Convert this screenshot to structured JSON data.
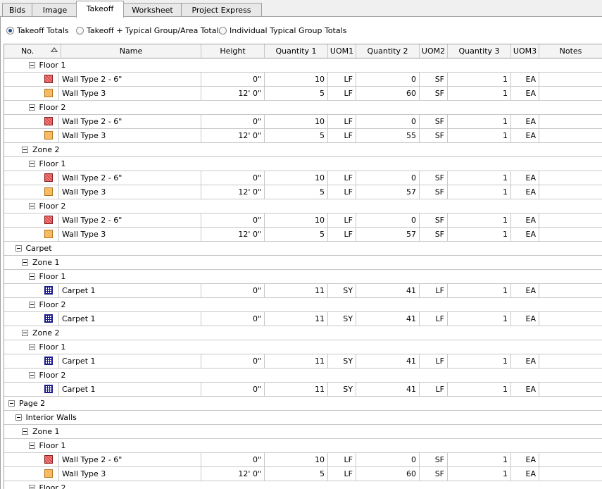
{
  "tabs": [
    "Bids",
    "Image",
    "Takeoff",
    "Worksheet",
    "Project Express"
  ],
  "active_tab": "Takeoff",
  "radio_options": [
    {
      "label": "Takeoff Totals",
      "selected": true
    },
    {
      "label": "Takeoff + Typical Group/Area Totals",
      "selected": false
    },
    {
      "label": "Individual Typical Group Totals",
      "selected": false
    }
  ],
  "columns": [
    "No.",
    "Name",
    "Height",
    "Quantity 1",
    "UOM1",
    "Quantity 2",
    "UOM2",
    "Quantity 3",
    "UOM3",
    "Notes"
  ],
  "rows": [
    {
      "type": "group",
      "level": 2,
      "label": "Floor 1"
    },
    {
      "type": "item",
      "swatch": "red",
      "name": "Wall Type 2 - 6\"",
      "height": "0\"",
      "q1": "10",
      "u1": "LF",
      "q2": "0",
      "u2": "SF",
      "q3": "1",
      "u3": "EA",
      "notes": ""
    },
    {
      "type": "item",
      "swatch": "orange",
      "name": "Wall Type 3",
      "height": "12' 0\"",
      "q1": "5",
      "u1": "LF",
      "q2": "60",
      "u2": "SF",
      "q3": "1",
      "u3": "EA",
      "notes": ""
    },
    {
      "type": "group",
      "level": 2,
      "label": "Floor 2"
    },
    {
      "type": "item",
      "swatch": "red",
      "name": "Wall Type 2 - 6\"",
      "height": "0\"",
      "q1": "10",
      "u1": "LF",
      "q2": "0",
      "u2": "SF",
      "q3": "1",
      "u3": "EA",
      "notes": ""
    },
    {
      "type": "item",
      "swatch": "orange",
      "name": "Wall Type 3",
      "height": "12' 0\"",
      "q1": "5",
      "u1": "LF",
      "q2": "55",
      "u2": "SF",
      "q3": "1",
      "u3": "EA",
      "notes": ""
    },
    {
      "type": "group",
      "level": 1,
      "label": "Zone 2"
    },
    {
      "type": "group",
      "level": 2,
      "label": "Floor 1"
    },
    {
      "type": "item",
      "swatch": "red",
      "name": "Wall Type 2 - 6\"",
      "height": "0\"",
      "q1": "10",
      "u1": "LF",
      "q2": "0",
      "u2": "SF",
      "q3": "1",
      "u3": "EA",
      "notes": ""
    },
    {
      "type": "item",
      "swatch": "orange",
      "name": "Wall Type 3",
      "height": "12' 0\"",
      "q1": "5",
      "u1": "LF",
      "q2": "57",
      "u2": "SF",
      "q3": "1",
      "u3": "EA",
      "notes": ""
    },
    {
      "type": "group",
      "level": 2,
      "label": "Floor 2"
    },
    {
      "type": "item",
      "swatch": "red",
      "name": "Wall Type 2 - 6\"",
      "height": "0\"",
      "q1": "10",
      "u1": "LF",
      "q2": "0",
      "u2": "SF",
      "q3": "1",
      "u3": "EA",
      "notes": ""
    },
    {
      "type": "item",
      "swatch": "orange",
      "name": "Wall Type 3",
      "height": "12' 0\"",
      "q1": "5",
      "u1": "LF",
      "q2": "57",
      "u2": "SF",
      "q3": "1",
      "u3": "EA",
      "notes": ""
    },
    {
      "type": "group",
      "level": 0,
      "label": "Carpet"
    },
    {
      "type": "group",
      "level": 1,
      "label": "Zone 1"
    },
    {
      "type": "group",
      "level": 2,
      "label": "Floor 1"
    },
    {
      "type": "item",
      "swatch": "blue",
      "name": "Carpet 1",
      "height": "0\"",
      "q1": "11",
      "u1": "SY",
      "q2": "41",
      "u2": "LF",
      "q3": "1",
      "u3": "EA",
      "notes": ""
    },
    {
      "type": "group",
      "level": 2,
      "label": "Floor 2"
    },
    {
      "type": "item",
      "swatch": "blue",
      "name": "Carpet 1",
      "height": "0\"",
      "q1": "11",
      "u1": "SY",
      "q2": "41",
      "u2": "LF",
      "q3": "1",
      "u3": "EA",
      "notes": ""
    },
    {
      "type": "group",
      "level": 1,
      "label": "Zone 2"
    },
    {
      "type": "group",
      "level": 2,
      "label": "Floor 1"
    },
    {
      "type": "item",
      "swatch": "blue",
      "name": "Carpet 1",
      "height": "0\"",
      "q1": "11",
      "u1": "SY",
      "q2": "41",
      "u2": "LF",
      "q3": "1",
      "u3": "EA",
      "notes": ""
    },
    {
      "type": "group",
      "level": 2,
      "label": "Floor 2"
    },
    {
      "type": "item",
      "swatch": "blue",
      "name": "Carpet 1",
      "height": "0\"",
      "q1": "11",
      "u1": "SY",
      "q2": "41",
      "u2": "LF",
      "q3": "1",
      "u3": "EA",
      "notes": ""
    },
    {
      "type": "group",
      "level": -1,
      "label": "Page 2"
    },
    {
      "type": "group",
      "level": 0,
      "label": "Interior Walls"
    },
    {
      "type": "group",
      "level": 1,
      "label": "Zone 1"
    },
    {
      "type": "group",
      "level": 2,
      "label": "Floor 1"
    },
    {
      "type": "item",
      "swatch": "red",
      "name": "Wall Type 2 - 6\"",
      "height": "0\"",
      "q1": "10",
      "u1": "LF",
      "q2": "0",
      "u2": "SF",
      "q3": "1",
      "u3": "EA",
      "notes": ""
    },
    {
      "type": "item",
      "swatch": "orange",
      "name": "Wall Type 3",
      "height": "12' 0\"",
      "q1": "5",
      "u1": "LF",
      "q2": "60",
      "u2": "SF",
      "q3": "1",
      "u3": "EA",
      "notes": ""
    },
    {
      "type": "group",
      "level": 2,
      "label": "Floor 2"
    }
  ]
}
